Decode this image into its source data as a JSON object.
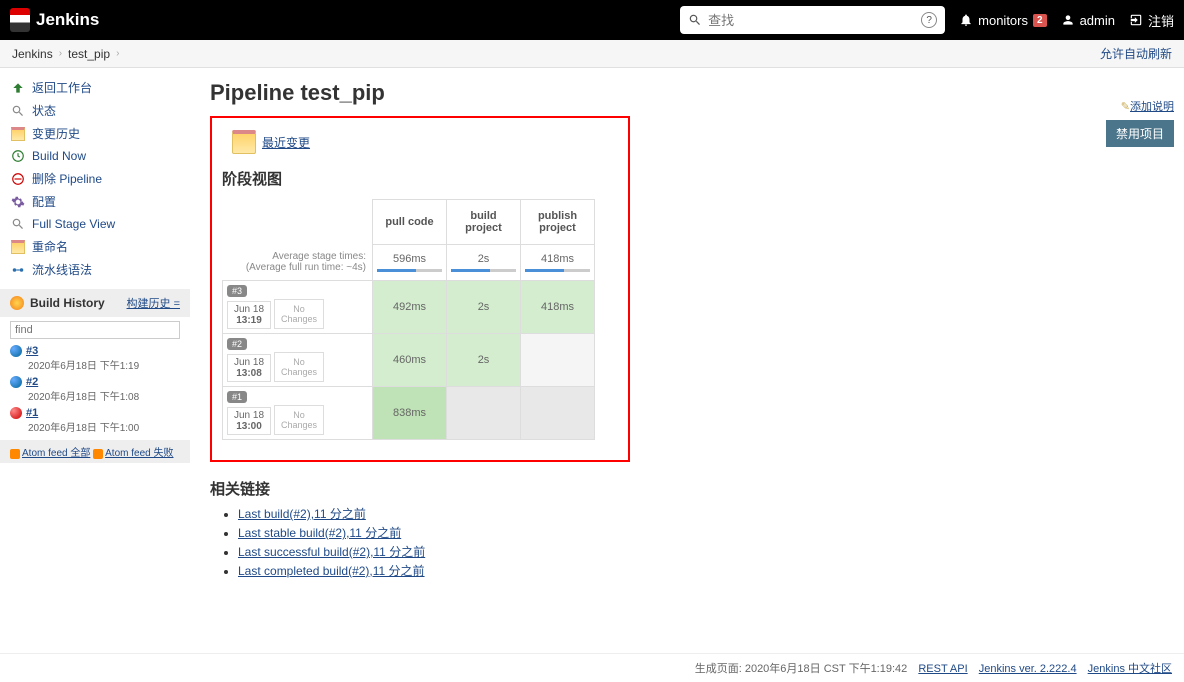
{
  "header": {
    "logo": "Jenkins",
    "search_placeholder": "查找",
    "monitors_label": "monitors",
    "monitors_count": "2",
    "user": "admin",
    "logout": "注销"
  },
  "breadcrumb": {
    "root": "Jenkins",
    "item": "test_pip",
    "auto_refresh": "允许自动刷新"
  },
  "sidebar": {
    "items": [
      {
        "icon": "up-arrow",
        "label": "返回工作台",
        "color": "#2e7d32"
      },
      {
        "icon": "magnifier",
        "label": "状态",
        "color": "#888"
      },
      {
        "icon": "notepad",
        "label": "变更历史",
        "color": "#c9a94f"
      },
      {
        "icon": "clock",
        "label": "Build Now",
        "color": "#2e7d32"
      },
      {
        "icon": "no-entry",
        "label": "删除 Pipeline",
        "color": "#c00"
      },
      {
        "icon": "gear",
        "label": "配置",
        "color": "#7a5ca0"
      },
      {
        "icon": "magnifier",
        "label": "Full Stage View",
        "color": "#888"
      },
      {
        "icon": "notepad",
        "label": "重命名",
        "color": "#c9a94f"
      },
      {
        "icon": "pipe",
        "label": "流水线语法",
        "color": "#2a6fb0"
      }
    ],
    "build_history": {
      "title": "Build History",
      "trend": "构建历史 =",
      "find_placeholder": "find",
      "builds": [
        {
          "num": "#3",
          "time": "2020年6月18日 下午1:19",
          "ball": "blue"
        },
        {
          "num": "#2",
          "time": "2020年6月18日 下午1:08",
          "ball": "blue"
        },
        {
          "num": "#1",
          "time": "2020年6月18日 下午1:00",
          "ball": "red"
        }
      ],
      "atom_all": "Atom feed 全部",
      "atom_fail": "Atom feed 失败"
    }
  },
  "page": {
    "title": "Pipeline test_pip",
    "add_desc": "添加说明",
    "disable_btn": "禁用项目",
    "recent_changes": "最近变更",
    "stage_view_title": "阶段视图",
    "related_title": "相关链接",
    "related_links": [
      "Last build(#2),11 分之前",
      "Last stable build(#2),11 分之前",
      "Last successful build(#2),11 分之前",
      "Last completed build(#2),11 分之前"
    ]
  },
  "stage_view": {
    "columns": [
      "pull code",
      "build project",
      "publish project"
    ],
    "avg_label_1": "Average stage times:",
    "avg_label_2": "(Average full run time: ~4s)",
    "avg_values": [
      "596ms",
      "2s",
      "418ms"
    ],
    "no_changes": "No Changes",
    "rows": [
      {
        "pill": "#3",
        "date": "Jun 18",
        "time": "13:19",
        "cells": [
          {
            "v": "492ms",
            "cls": "stage-green"
          },
          {
            "v": "2s",
            "cls": "stage-green"
          },
          {
            "v": "418ms",
            "cls": "stage-green"
          }
        ]
      },
      {
        "pill": "#2",
        "date": "Jun 18",
        "time": "13:08",
        "cells": [
          {
            "v": "460ms",
            "cls": "stage-green"
          },
          {
            "v": "2s",
            "cls": "stage-green"
          },
          {
            "v": "",
            "cls": "stage-empty"
          }
        ]
      },
      {
        "pill": "#1",
        "date": "Jun 18",
        "time": "13:00",
        "cells": [
          {
            "v": "838ms",
            "cls": "stage-green-dark"
          },
          {
            "v": "",
            "cls": "stage-gray"
          },
          {
            "v": "",
            "cls": "stage-gray"
          }
        ]
      }
    ]
  },
  "footer": {
    "gen_text": "生成页面: 2020年6月18日 CST 下午1:19:42",
    "rest_api": "REST API",
    "version": "Jenkins ver. 2.222.4",
    "community": "Jenkins 中文社区"
  }
}
